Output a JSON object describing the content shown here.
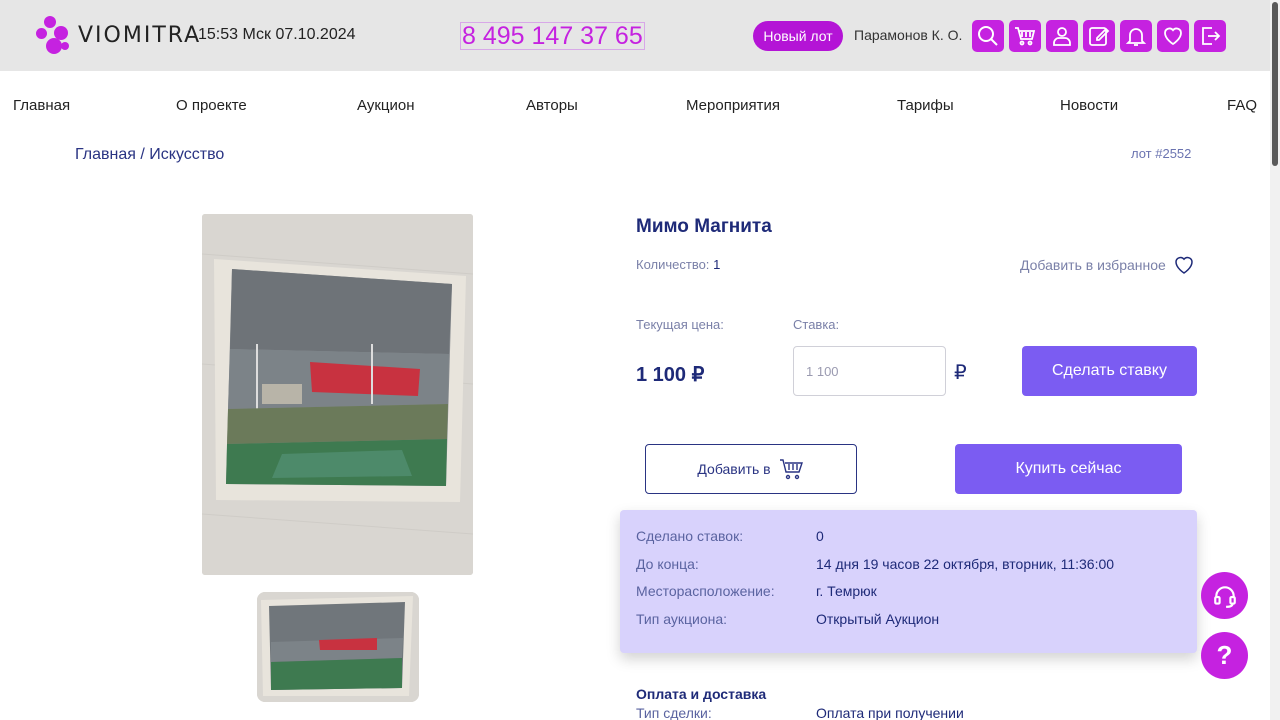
{
  "brand": {
    "name": "VIOMITRA",
    "accent": "#c522e0",
    "button_color": "#7b5cf2"
  },
  "header": {
    "clock": "15:53 Мск 07.10.2024",
    "phone": "8 495 147 37 65",
    "new_lot_label": "Новый лот",
    "user_name": "Парамонов К. О.",
    "icons": [
      "search-icon",
      "cart-icon",
      "user-icon",
      "edit-icon",
      "bell-icon",
      "heart-icon",
      "logout-icon"
    ]
  },
  "nav": {
    "items": [
      {
        "label": "Главная"
      },
      {
        "label": "О проекте"
      },
      {
        "label": "Аукцион"
      },
      {
        "label": "Авторы"
      },
      {
        "label": "Мероприятия"
      },
      {
        "label": "Тарифы"
      },
      {
        "label": "Новости"
      },
      {
        "label": "FAQ"
      }
    ]
  },
  "breadcrumb": {
    "home": "Главная",
    "separator": "/",
    "current": "Искусство"
  },
  "lot": {
    "number": "лот #2552",
    "title": "Мимо Магнита",
    "quantity_label": "Количество:",
    "quantity_value": "1",
    "favorite_label": "Добавить в избранное",
    "current_price_label": "Текущая цена:",
    "current_price": "1 100 ₽",
    "bid_label": "Ставка:",
    "bid_placeholder": "1 100",
    "currency_symbol": "₽",
    "bid_button": "Сделать ставку",
    "add_to_cart_button": "Добавить в",
    "buy_now_button": "Купить сейчас"
  },
  "info": {
    "rows": [
      {
        "key": "Сделано ставок:",
        "value": "0"
      },
      {
        "key": "До конца:",
        "value": "14 дня 19 часов 22 октября, вторник, 11:36:00"
      },
      {
        "key": "Месторасположение:",
        "value": "г. Темрюк"
      },
      {
        "key": "Тип аукциона:",
        "value": "Открытый Аукцион"
      }
    ]
  },
  "payment": {
    "title": "Оплата и доставка",
    "deal_type_key": "Тип сделки:",
    "deal_type_value": "Оплата при получении"
  },
  "float_buttons": {
    "help_mark": "?"
  }
}
